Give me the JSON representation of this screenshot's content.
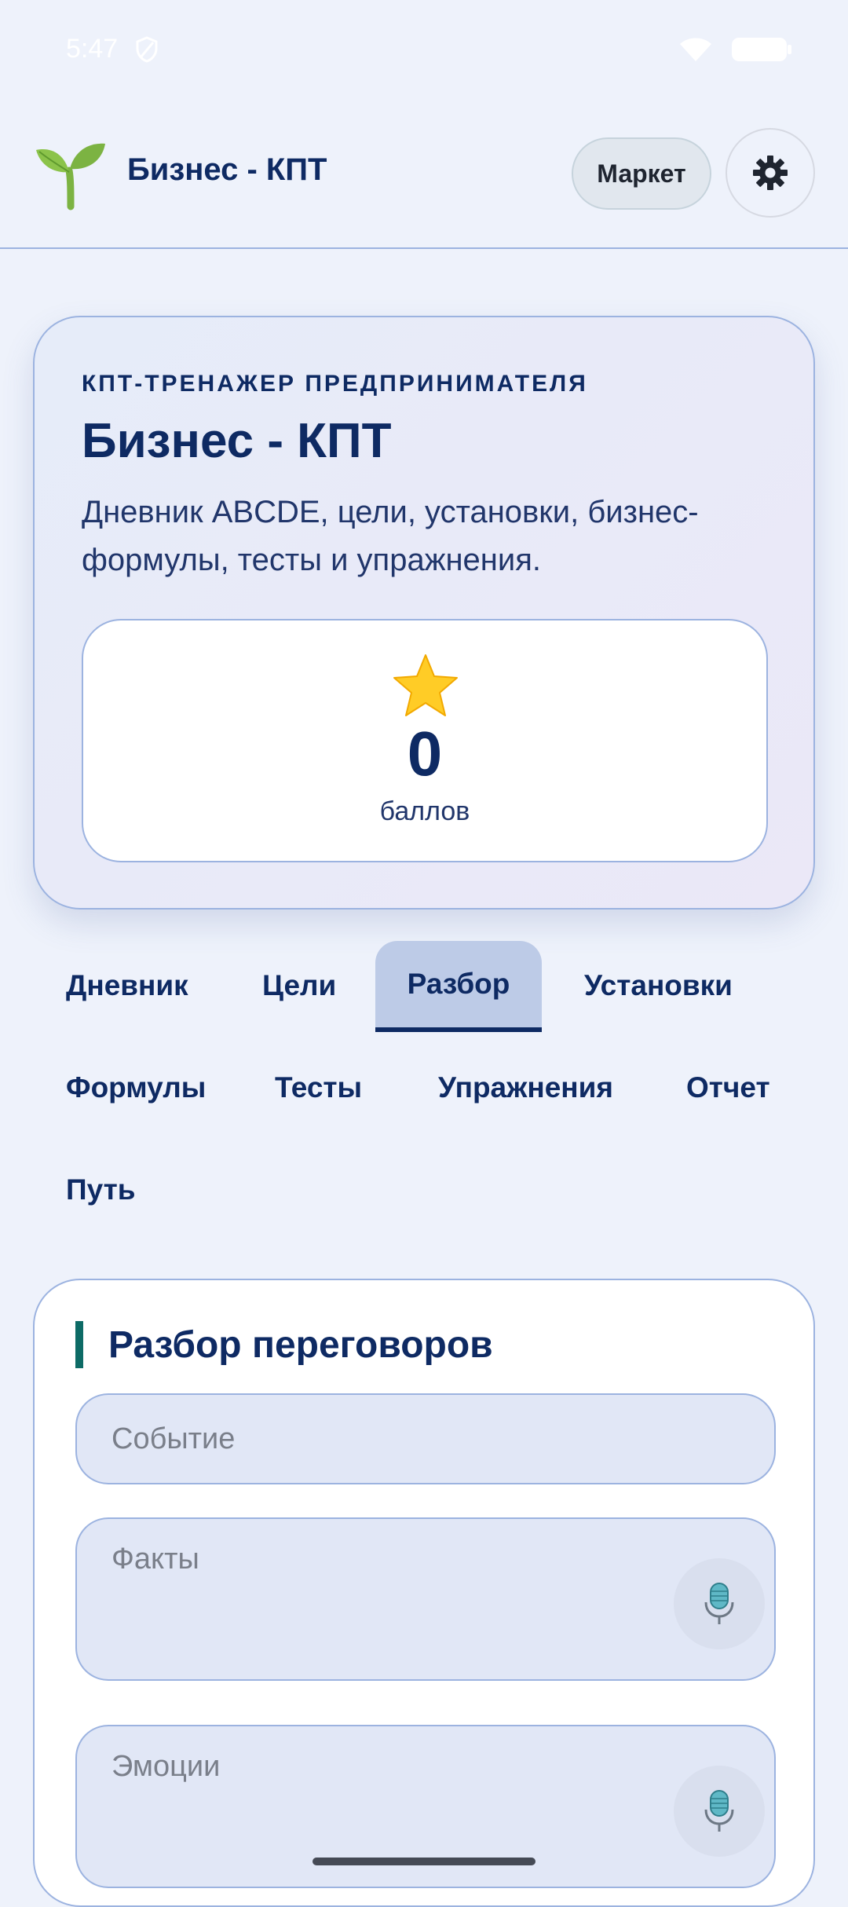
{
  "status_bar": {
    "time": "5:47"
  },
  "app_bar": {
    "title": "Бизнес - КПТ",
    "market_label": "Маркет",
    "logo_icon": "sprout-icon",
    "settings_icon": "gear-icon"
  },
  "hero": {
    "kicker": "КПТ-ТРЕНАЖЕР ПРЕДПРИНИМАТЕЛЯ",
    "title": "Бизнес - КПТ",
    "description": "Дневник ABCDE, цели, установки, бизнес-формулы, тесты и упражнения.",
    "score": {
      "icon": "star-icon",
      "value": "0",
      "label": "баллов"
    }
  },
  "tabs": [
    {
      "label": "Дневник"
    },
    {
      "label": "Цели"
    },
    {
      "label": "Разбор",
      "active": true
    },
    {
      "label": "Установки"
    },
    {
      "label": "Формулы"
    },
    {
      "label": "Тесты"
    },
    {
      "label": "Упражнения"
    },
    {
      "label": "Отчет"
    },
    {
      "label": "Путь"
    }
  ],
  "form": {
    "title": "Разбор переговоров",
    "event_placeholder": "Событие",
    "facts_placeholder": "Факты",
    "emotions_placeholder": "Эмоции",
    "mic_icon": "microphone-icon"
  },
  "colors": {
    "background": "#eef2fb",
    "primary_text": "#0e2a63",
    "accent": "#0d6b66",
    "active_tab": "#bdcbe7"
  }
}
